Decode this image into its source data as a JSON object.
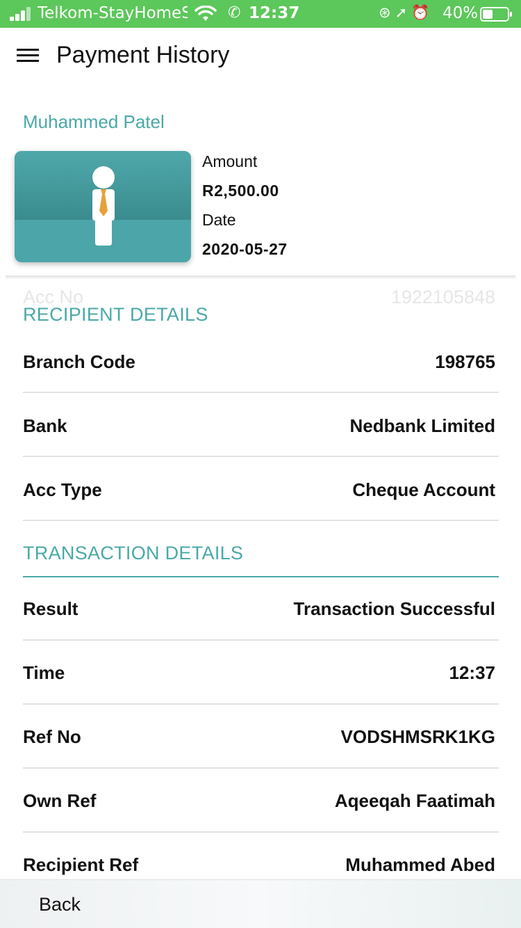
{
  "status_bar": {
    "carrier": "Telkom-StayHomeS",
    "time": "12:37",
    "battery_percent": "40%",
    "battery_level": 0.4,
    "color": "#5cc75a"
  },
  "header": {
    "title": "Payment History",
    "menu_icon": "hamburger-menu-icon"
  },
  "payee": {
    "name": "Muhammed Patel",
    "amount_label": "Amount",
    "amount": "R2,500.00",
    "date_label": "Date",
    "date": "2020-05-27"
  },
  "faded_row": {
    "label": "Acc No",
    "value": "1922105848"
  },
  "recipient_details": {
    "heading": "RECIPIENT DETAILS",
    "rows": [
      {
        "label": "Branch Code",
        "value": "198765"
      },
      {
        "label": "Bank",
        "value": "Nedbank Limited"
      },
      {
        "label": "Acc Type",
        "value": "Cheque Account"
      }
    ]
  },
  "transaction_details": {
    "heading": "TRANSACTION DETAILS",
    "rows": [
      {
        "label": "Result",
        "value": "Transaction Successful"
      },
      {
        "label": "Time",
        "value": "12:37"
      },
      {
        "label": "Ref No",
        "value": "VODSHMSRK1KG"
      },
      {
        "label": "Own Ref",
        "value": "Aqeeqah Faatimah"
      },
      {
        "label": "Recipient Ref",
        "value": "Muhammed Abed"
      }
    ]
  },
  "footer": {
    "back_label": "Back"
  },
  "colors": {
    "accent": "#4aa8a8",
    "card": "#4ca6a9",
    "tie": "#e6a13a"
  }
}
